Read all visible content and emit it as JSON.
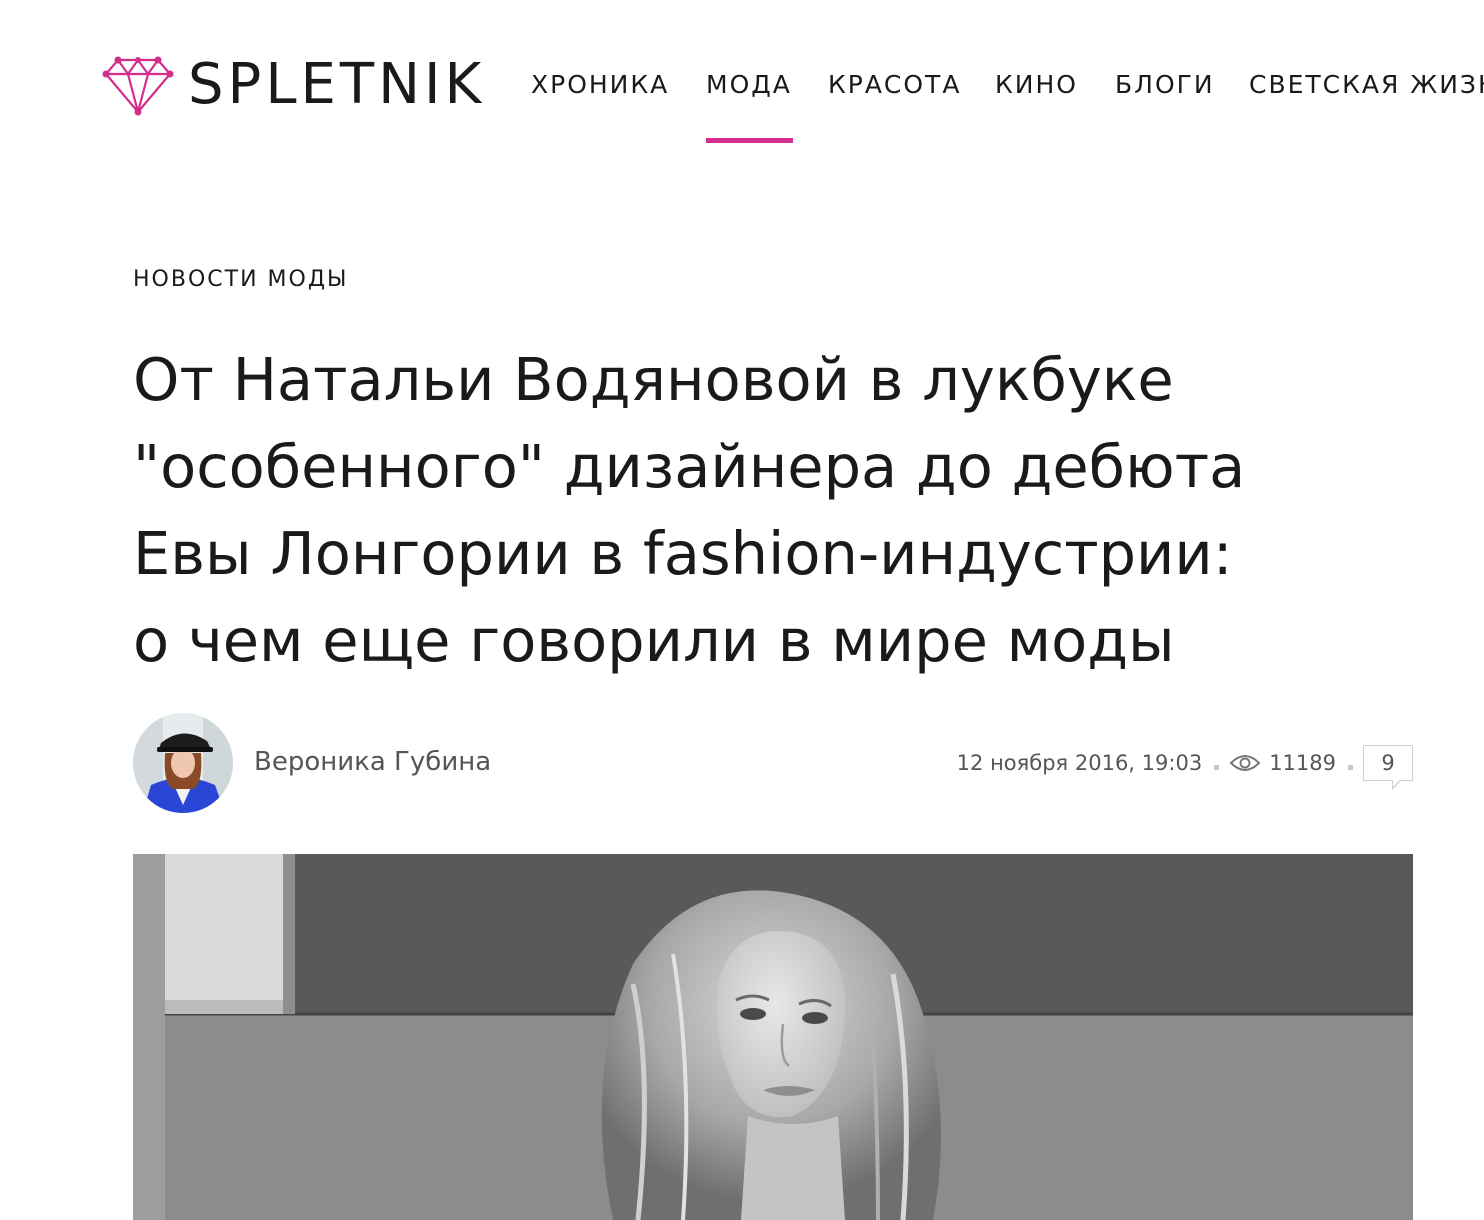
{
  "header": {
    "logo_text": "SPLETNIK",
    "nav": [
      {
        "label": "ХРОНИКА",
        "active": false
      },
      {
        "label": "МОДА",
        "active": true
      },
      {
        "label": "КРАСОТА",
        "active": false
      },
      {
        "label": "КИНО",
        "active": false
      },
      {
        "label": "БЛОГИ",
        "active": false
      },
      {
        "label": "СВЕТСКАЯ ЖИЗНЬ",
        "active": false
      }
    ],
    "accent_color": "#d42d8c"
  },
  "article": {
    "category": "НОВОСТИ МОДЫ",
    "title_lines": [
      "От Натальи Водяновой в лукбуке",
      "\"особенного\" дизайнера до дебюта",
      "Евы Лонгории в fashion-индустрии:",
      "о чем еще говорили в мире моды"
    ],
    "author": "Вероника Губина",
    "date": "12 ноября 2016, 19:03",
    "views": "11189",
    "comments": "9",
    "icons": {
      "views": "eye-icon",
      "comments": "comment-bubble-icon",
      "logo": "diamond-logo-icon"
    }
  }
}
